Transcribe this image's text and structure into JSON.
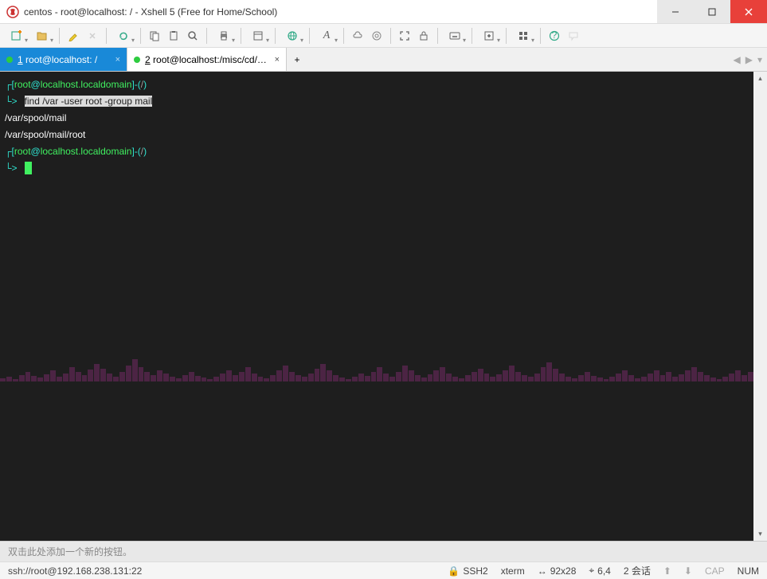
{
  "window": {
    "title": "centos - root@localhost: / - Xshell 5 (Free for Home/School)"
  },
  "tabs": [
    {
      "num": "1",
      "label": " root@localhost: /",
      "active": true
    },
    {
      "num": "2",
      "label": " root@localhost:/misc/cd/Pa...",
      "active": false
    }
  ],
  "terminal": {
    "prompt_user": "root",
    "prompt_at": "@",
    "prompt_host": "localhost.localdomain",
    "prompt_path": "/",
    "command_selected": "find /var -user root -group mail",
    "output": [
      "/var/spool/mail",
      "/var/spool/mail/root"
    ]
  },
  "hint": "双击此处添加一个新的按钮。",
  "status": {
    "conn": "ssh://root@192.168.238.131:22",
    "proto": "SSH2",
    "term": "xterm",
    "size": "92x28",
    "pos": "6,4",
    "sess": "2 会话",
    "caps": "CAP",
    "num": "NUM"
  },
  "icons": {
    "lock": "🔒",
    "arrows": "↔",
    "cursor": "⌖",
    "up": "⬆",
    "down": "⬇"
  }
}
